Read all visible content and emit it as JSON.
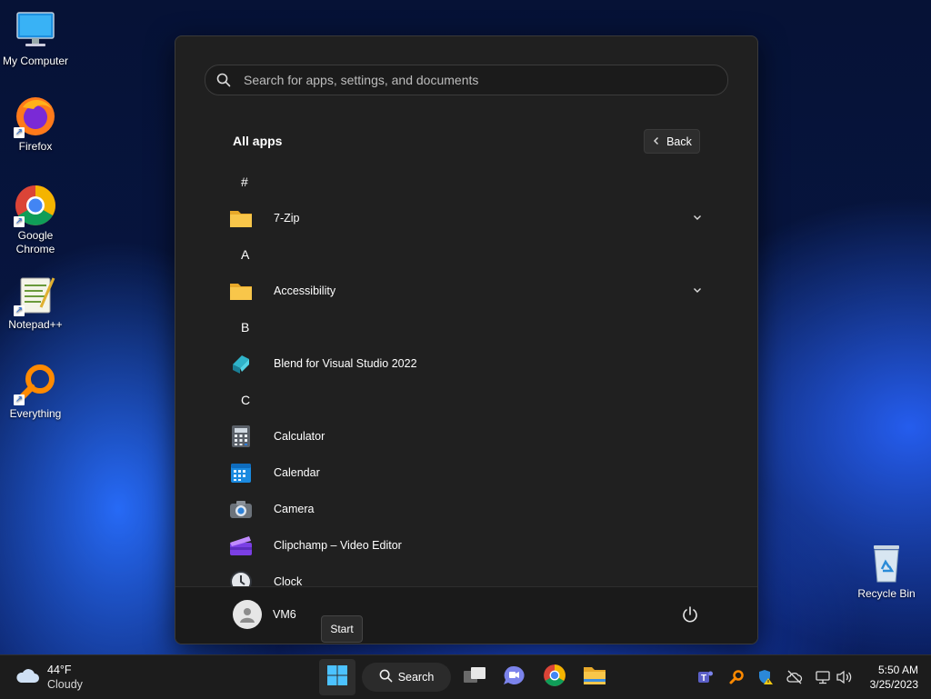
{
  "desktop": {
    "icons": [
      {
        "label": "My Computer"
      },
      {
        "label": "Firefox"
      },
      {
        "label": "Google\nChrome"
      },
      {
        "label": "Notepad++"
      },
      {
        "label": "Everything"
      },
      {
        "label": "Recycle Bin"
      }
    ]
  },
  "start_menu": {
    "search_placeholder": "Search for apps, settings, and documents",
    "all_apps_title": "All apps",
    "back_label": "Back",
    "sections": [
      {
        "letter": "#"
      },
      {
        "letter": "A"
      },
      {
        "letter": "B"
      },
      {
        "letter": "C"
      }
    ],
    "apps": [
      {
        "name": "7-Zip",
        "icon": "folder-icon",
        "expandable": true
      },
      {
        "name": "Accessibility",
        "icon": "folder-icon",
        "expandable": true
      },
      {
        "name": "Blend for Visual Studio 2022",
        "icon": "blend-icon"
      },
      {
        "name": "Calculator",
        "icon": "calculator-icon"
      },
      {
        "name": "Calendar",
        "icon": "calendar-icon"
      },
      {
        "name": "Camera",
        "icon": "camera-icon"
      },
      {
        "name": "Clipchamp – Video Editor",
        "icon": "clipchamp-icon"
      },
      {
        "name": "Clock",
        "icon": "clock-icon"
      }
    ],
    "user_name": "VM6",
    "tooltip": "Start"
  },
  "taskbar": {
    "weather_temp": "44°F",
    "weather_condition": "Cloudy",
    "search_label": "Search",
    "time": "5:50 AM",
    "date": "3/25/2023"
  },
  "colors": {
    "accent": "#0078d4",
    "menu_bg": "#202020",
    "taskbar_bg": "#1c1c1c",
    "folder": "#f8c64a"
  }
}
